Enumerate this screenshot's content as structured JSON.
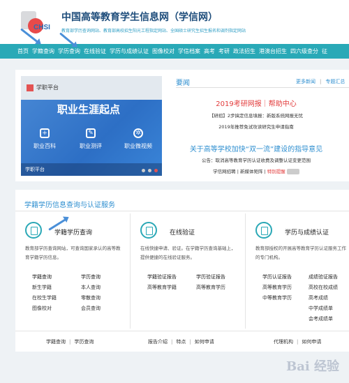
{
  "header": {
    "logo_text": "CHSI",
    "title": "中国高等教育学生信息网（学信网）",
    "subtitle": "教育部学历查询网站、教育部高校招生阳光工程指定网站、全国硕士研究生招生报名和调剂指定网站"
  },
  "nav": [
    "首页",
    "学籍查询",
    "学历查询",
    "在线验证",
    "学历与成绩认证",
    "图像校对",
    "学信档案",
    "高考",
    "考研",
    "政法招生",
    "港澳台招生",
    "四六级查分",
    "征"
  ],
  "banner": {
    "platform": "学职平台",
    "headline": "职业生涯起点",
    "features": [
      "职业百科",
      "职业测评",
      "职业微视频"
    ],
    "footer": "学职平台"
  },
  "news": {
    "title": "要闻",
    "more": "更多新闻",
    "more2": "专题汇总",
    "headline1": "2019考研网报｜帮助中心",
    "line1": "【研招】2步搞定信息填报：新版系统网报无忧",
    "line2": "2019年推荐免试攻读研究生申请指南",
    "headline2": "关于高等学校加快“双一流”建设的指导意见",
    "line3": "公告：取消高等教育学历认证收费及调整认证变更范围",
    "line4a": "学信网招聘",
    "line4b": "新媒体矩阵",
    "line4c": "特别提醒"
  },
  "services": {
    "title": "学籍学历信息查询与认证服务",
    "columns": [
      {
        "name": "学籍学历查询",
        "desc": "教育部学历查询网站，可查询国家承认的高等教育学籍学历信息。",
        "grid": [
          [
            "学籍查询",
            "学历查询"
          ],
          [
            "新生学籍",
            "本人查询"
          ],
          [
            "在校生学籍",
            "零散查询"
          ],
          [
            "图像校对",
            "会员查询"
          ]
        ],
        "links": [
          "学籍查询",
          "学历查询"
        ]
      },
      {
        "name": "在线验证",
        "desc": "在线快捷申请、验证。在学籍学历查询基础上，提供便捷的在线验证服务。",
        "grid": [
          [
            "学籍验证报告",
            "学历验证报告"
          ],
          [
            "高等教育学籍",
            "高等教育学历"
          ]
        ],
        "links": [
          "报告介绍",
          "特点",
          "如何申请"
        ]
      },
      {
        "name": "学历与成绩认证",
        "desc": "教育部授权的开展高等教育学历认证服务工作的专门机构。",
        "grid": [
          [
            "学历认证报告",
            "成绩验证报告"
          ],
          [
            "高等教育学历",
            "高校在校成绩"
          ],
          [
            "中等教育学历",
            "高考成绩"
          ],
          [
            "",
            "中学成绩单"
          ],
          [
            "",
            "会考成绩单"
          ]
        ],
        "links": [
          "代理机构",
          "如何申请"
        ]
      }
    ]
  },
  "watermark": "Bai 经验",
  "colors": {
    "nav_bg": "#29a9b7",
    "accent_blue": "#2f8fd0",
    "accent_red": "#e23b3b"
  }
}
